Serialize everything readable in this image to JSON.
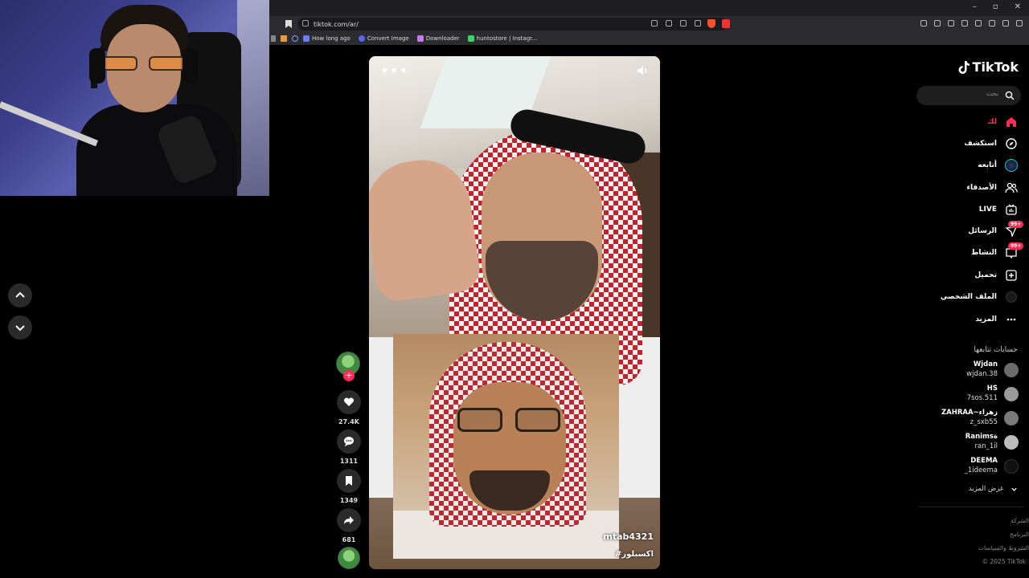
{
  "browser": {
    "url": "tiktok.com/ar/",
    "bookmarks": [
      {
        "label": "How long ago",
        "color": "#6a7cff"
      },
      {
        "label": "Convert Image",
        "color": "#5866e8"
      },
      {
        "label": "Downloader",
        "color": "#c77bf0"
      },
      {
        "label": "huntostore | Instagr...",
        "color": "#3ad36a"
      }
    ],
    "window_controls": [
      "–",
      "▫",
      "✕"
    ]
  },
  "video": {
    "watermark": "mtab4321",
    "hashtag": "#اكسبلور"
  },
  "actions": {
    "plus": "+",
    "likes": "27.4K",
    "comments": "1311",
    "saves": "1349",
    "shares": "681"
  },
  "sidebar": {
    "logo": "TikTok",
    "search_placeholder": "بحث",
    "menu": [
      {
        "label": "لك",
        "icon": "home-icon"
      },
      {
        "label": "استكشف",
        "icon": "compass-icon"
      },
      {
        "label": "أتابعه",
        "icon": "following-avatar-icon"
      },
      {
        "label": "الأصدقاء",
        "icon": "friends-icon"
      },
      {
        "label": "LIVE",
        "icon": "live-icon"
      },
      {
        "label": "الرسائل",
        "icon": "messages-icon",
        "badge": "99+"
      },
      {
        "label": "النشاط",
        "icon": "activity-icon",
        "badge": "99+"
      },
      {
        "label": "تحميل",
        "icon": "upload-icon"
      },
      {
        "label": "الملف الشخصي",
        "icon": "profile-icon"
      },
      {
        "label": "المزيد",
        "icon": "more-icon"
      }
    ],
    "following_title": "حسابات تتابعها",
    "following": [
      {
        "name": "Wjdan",
        "handle": "wjdan.38",
        "color": "#6b6b6b"
      },
      {
        "name": "HS",
        "handle": "7sos.511",
        "color": "#9a9a9a"
      },
      {
        "name": "ZAHRAA~زهراء",
        "handle": "z_sxb55",
        "color": "#7a7a7a"
      },
      {
        "name": "Ranimsة",
        "handle": "ran_1il",
        "color": "#bdbdbd"
      },
      {
        "name": "DEEMA",
        "handle": "_1ideema",
        "color": "#111111"
      }
    ],
    "show_more": "عرض المزيد",
    "footer": [
      "الشركة",
      "البرنامج",
      "الشروط والسياسات",
      "© 2025 TikTok"
    ]
  },
  "colors": {
    "accent": "#fe2c55",
    "background": "#000000"
  }
}
